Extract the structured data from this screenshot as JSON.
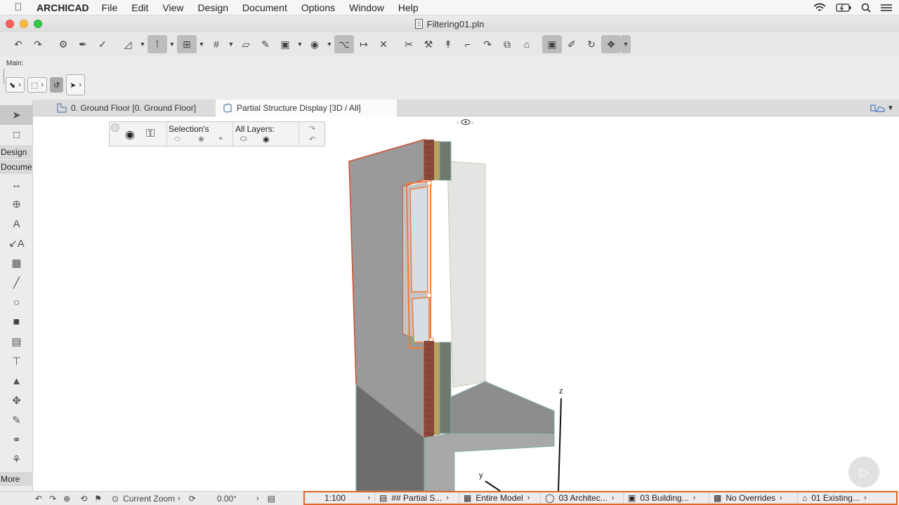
{
  "menubar": {
    "app_name": "ARCHICAD",
    "items": [
      "File",
      "Edit",
      "View",
      "Design",
      "Document",
      "Options",
      "Window",
      "Help"
    ]
  },
  "window": {
    "title": "Filtering01.pln"
  },
  "toolbar": {
    "main_label": "Main:"
  },
  "toolbox": {
    "design_label": "Design",
    "document_label": "Docume",
    "more_label": "More"
  },
  "tabs": [
    {
      "label": "0. Ground Floor [0. Ground Floor]"
    },
    {
      "label": "Partial Structure Display [3D / All]"
    }
  ],
  "filter_palette": {
    "selection_label": "Selection's",
    "all_layers_label": "All Layers:"
  },
  "axes": {
    "z": "z",
    "y": "y"
  },
  "bottom": {
    "zoom_label": "Current Zoom",
    "angle": "0.00°"
  },
  "viewbar": {
    "scale": "1:100",
    "structure": "## Partial S...",
    "model": "Entire Model",
    "pen_set": "03 Architec...",
    "model_view": "03 Building...",
    "overrides": "No Overrides",
    "renovation": "01 Existing..."
  },
  "colors": {
    "highlight": "#e0662a",
    "selection": "#f07a3c"
  }
}
